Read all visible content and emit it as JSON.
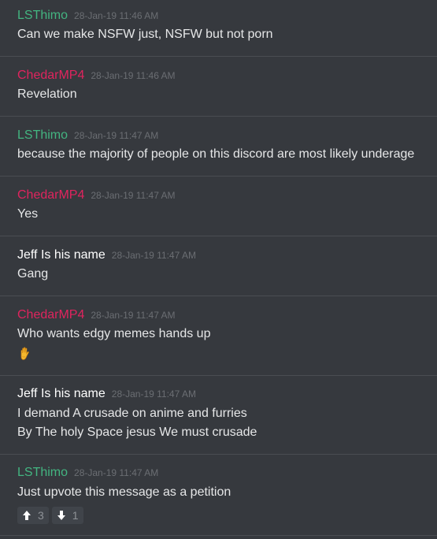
{
  "colors": {
    "background": "#36393e",
    "separator": "#4a4d52",
    "timestamp": "#6b6e73",
    "message_text": "#e6e7e8"
  },
  "messages": [
    {
      "author": "LSThimo",
      "author_color": "#43b581",
      "timestamp": "28-Jan-19 11:46 AM",
      "lines": [
        "Can we make NSFW just, NSFW but not porn"
      ]
    },
    {
      "author": "ChedarMP4",
      "author_color": "#e0245e",
      "timestamp": "28-Jan-19 11:46 AM",
      "lines": [
        "Revelation"
      ]
    },
    {
      "author": "LSThimo",
      "author_color": "#43b581",
      "timestamp": "28-Jan-19 11:47 AM",
      "lines": [
        "because the majority of people on this discord are most likely underage"
      ]
    },
    {
      "author": "ChedarMP4",
      "author_color": "#e0245e",
      "timestamp": "28-Jan-19 11:47 AM",
      "lines": [
        "Yes"
      ]
    },
    {
      "author": "Jeff Is his name",
      "author_color": "#ffffff",
      "timestamp": "28-Jan-19 11:47 AM",
      "lines": [
        "Gang"
      ]
    },
    {
      "author": "ChedarMP4",
      "author_color": "#e0245e",
      "timestamp": "28-Jan-19 11:47 AM",
      "lines": [
        "Who wants edgy memes hands up"
      ],
      "emoji": "raised-hand-icon"
    },
    {
      "author": "Jeff Is his name",
      "author_color": "#ffffff",
      "timestamp": "28-Jan-19 11:47 AM",
      "lines": [
        "I demand A crusade on anime and furries",
        "By The holy Space jesus We must crusade"
      ]
    },
    {
      "author": "LSThimo",
      "author_color": "#43b581",
      "timestamp": "28-Jan-19 11:47 AM",
      "lines": [
        "Just upvote this message as a petition"
      ],
      "reactions": [
        {
          "icon": "arrow-up-icon",
          "count": "3"
        },
        {
          "icon": "arrow-down-icon",
          "count": "1"
        }
      ]
    }
  ]
}
